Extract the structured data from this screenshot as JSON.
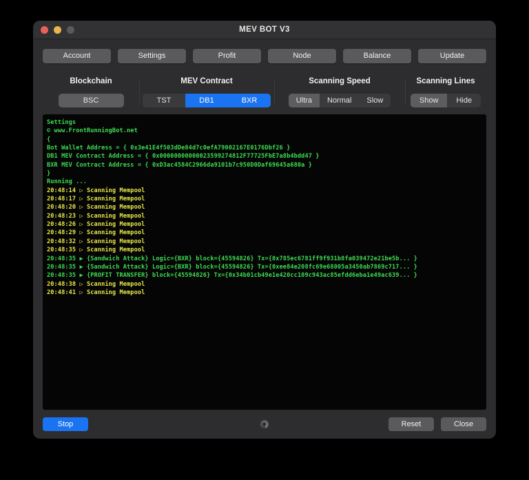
{
  "window": {
    "title": "MEV BOT V3",
    "traffic_lights": [
      "close",
      "minimize",
      "zoom"
    ]
  },
  "nav": {
    "buttons": [
      {
        "label": "Account"
      },
      {
        "label": "Settings"
      },
      {
        "label": "Profit"
      },
      {
        "label": "Node"
      },
      {
        "label": "Balance"
      },
      {
        "label": "Update"
      }
    ]
  },
  "options": {
    "blockchain": {
      "title": "Blockchain",
      "items": [
        {
          "label": "BSC",
          "state": "selected-gray"
        }
      ]
    },
    "mev_contract": {
      "title": "MEV Contract",
      "items": [
        {
          "label": "TST",
          "state": "normal"
        },
        {
          "label": "DB1",
          "state": "selected-blue"
        },
        {
          "label": "BXR",
          "state": "selected-blue"
        }
      ]
    },
    "scanning_speed": {
      "title": "Scanning Speed",
      "items": [
        {
          "label": "Ultra",
          "state": "selected-gray"
        },
        {
          "label": "Normal",
          "state": "normal"
        },
        {
          "label": "Slow",
          "state": "normal"
        }
      ]
    },
    "scanning_lines": {
      "title": "Scanning Lines",
      "items": [
        {
          "label": "Show",
          "state": "selected-gray"
        },
        {
          "label": "Hide",
          "state": "normal"
        }
      ]
    }
  },
  "terminal": {
    "lines": [
      {
        "color": "green",
        "text": "Settings"
      },
      {
        "color": "green",
        "text": "© www.FrontRunningBot.net"
      },
      {
        "color": "green",
        "text": "{"
      },
      {
        "color": "green",
        "text": "Bot Wallet Address = { 0x3e41E4f503dDe84d7c0efA79002167E0176Dbf26 }"
      },
      {
        "color": "green",
        "text": "DB1 MEV Contract Address = { 0x00000000000023599274812F77725FbE7a8b4bdd47 }"
      },
      {
        "color": "green",
        "text": "BXR MEV Contract Address = { 0xD3ac4584C2966da9101b7c950D0Daf69645a680a }"
      },
      {
        "color": "green",
        "text": "}"
      },
      {
        "color": "green",
        "text": "Running ..."
      },
      {
        "color": "yellow",
        "text": "20:48:14 ▷ Scanning Mempool"
      },
      {
        "color": "yellow",
        "text": "20:48:17 ▷ Scanning Mempool"
      },
      {
        "color": "yellow",
        "text": "20:48:20 ▷ Scanning Mempool"
      },
      {
        "color": "yellow",
        "text": "20:48:23 ▷ Scanning Mempool"
      },
      {
        "color": "yellow",
        "text": "20:48:26 ▷ Scanning Mempool"
      },
      {
        "color": "yellow",
        "text": "20:48:29 ▷ Scanning Mempool"
      },
      {
        "color": "yellow",
        "text": "20:48:32 ▷ Scanning Mempool"
      },
      {
        "color": "yellow",
        "text": "20:48:35 ▷ Scanning Mempool"
      },
      {
        "color": "green",
        "text": "20:48:35 ▶ {Sandwich Attack} Logic={BXR} block={45594826} Tx={0x785ec6781ff9f931b8fa039472e21be5b... }"
      },
      {
        "color": "green",
        "text": "20:48:35 ▶ {Sandwich Attack} Logic={BXR} block={45594826} Tx={0xee84e208fc69e68005a3450ab7869c717... }"
      },
      {
        "color": "green",
        "text": "20:48:35 ▶ {PROFIT TRANSFER} block={45594826} Tx={0x34b01cb49e1e420cc109c943ac85efdd6eba1e49ac639... }"
      },
      {
        "color": "yellow",
        "text": "20:48:38 ▷ Scanning Mempool"
      },
      {
        "color": "yellow",
        "text": "20:48:41 ▷ Scanning Mempool"
      }
    ]
  },
  "footer": {
    "stop_label": "Stop",
    "reset_label": "Reset",
    "close_label": "Close",
    "spinner": "loading-spinner"
  },
  "colors": {
    "accent_blue": "#1a73f0",
    "terminal_green": "#3ddc52",
    "terminal_yellow": "#e8e84a",
    "window_bg": "#2d2d2f",
    "terminal_bg": "#050505"
  }
}
